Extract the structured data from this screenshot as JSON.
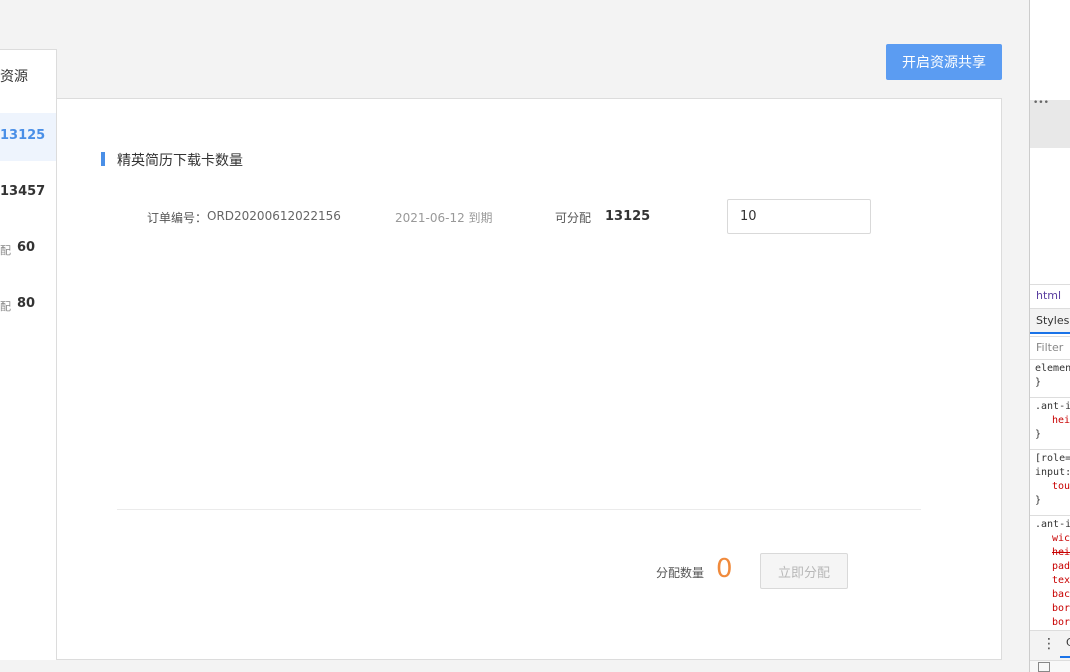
{
  "tab": {
    "label": "资源"
  },
  "left_items": [
    {
      "prefix": "",
      "value": "13125",
      "active": true
    },
    {
      "prefix": "",
      "value": "13457",
      "active": false
    },
    {
      "prefix": "配",
      "value": "60",
      "active": false
    },
    {
      "prefix": "配",
      "value": "80",
      "active": false
    }
  ],
  "share_button": "开启资源共享",
  "section": {
    "title": "精英简历下载卡数量"
  },
  "order": {
    "label": "订单编号：",
    "number": "ORD20200612022156",
    "expiry": "2021-06-12 到期",
    "assignable_label": "可分配",
    "assignable_value": "13125",
    "input_value": "10"
  },
  "footer": {
    "total_label": "分配数量",
    "total_value": "0",
    "assign_button": "立即分配"
  },
  "devtools": {
    "dots": "•••",
    "breadcrumb": "html",
    "styles_tab": "Styles",
    "filter_placeholder": "Filter",
    "code_lines": [
      {
        "text": "element",
        "cls": ""
      },
      {
        "text": "}",
        "cls": ""
      },
      {
        "sep": true
      },
      {
        "text": ".ant-i",
        "cls": ""
      },
      {
        "text": "hei",
        "cls": "red"
      },
      {
        "text": "}",
        "cls": ""
      },
      {
        "sep": true
      },
      {
        "text": "[role=",
        "cls": ""
      },
      {
        "text": "input:",
        "cls": ""
      },
      {
        "text": "tou",
        "cls": "red"
      },
      {
        "text": "}",
        "cls": ""
      },
      {
        "sep": true
      },
      {
        "text": ".ant-i",
        "cls": ""
      },
      {
        "text": "wic",
        "cls": "red"
      },
      {
        "text": "hei",
        "cls": "red strike"
      },
      {
        "text": "pad",
        "cls": "red"
      },
      {
        "text": "tex",
        "cls": "red"
      },
      {
        "text": "bac",
        "cls": "red"
      },
      {
        "text": "bor",
        "cls": "red"
      },
      {
        "text": "bor",
        "cls": "red"
      }
    ],
    "kebab": "⋮",
    "console_tab": "C"
  }
}
